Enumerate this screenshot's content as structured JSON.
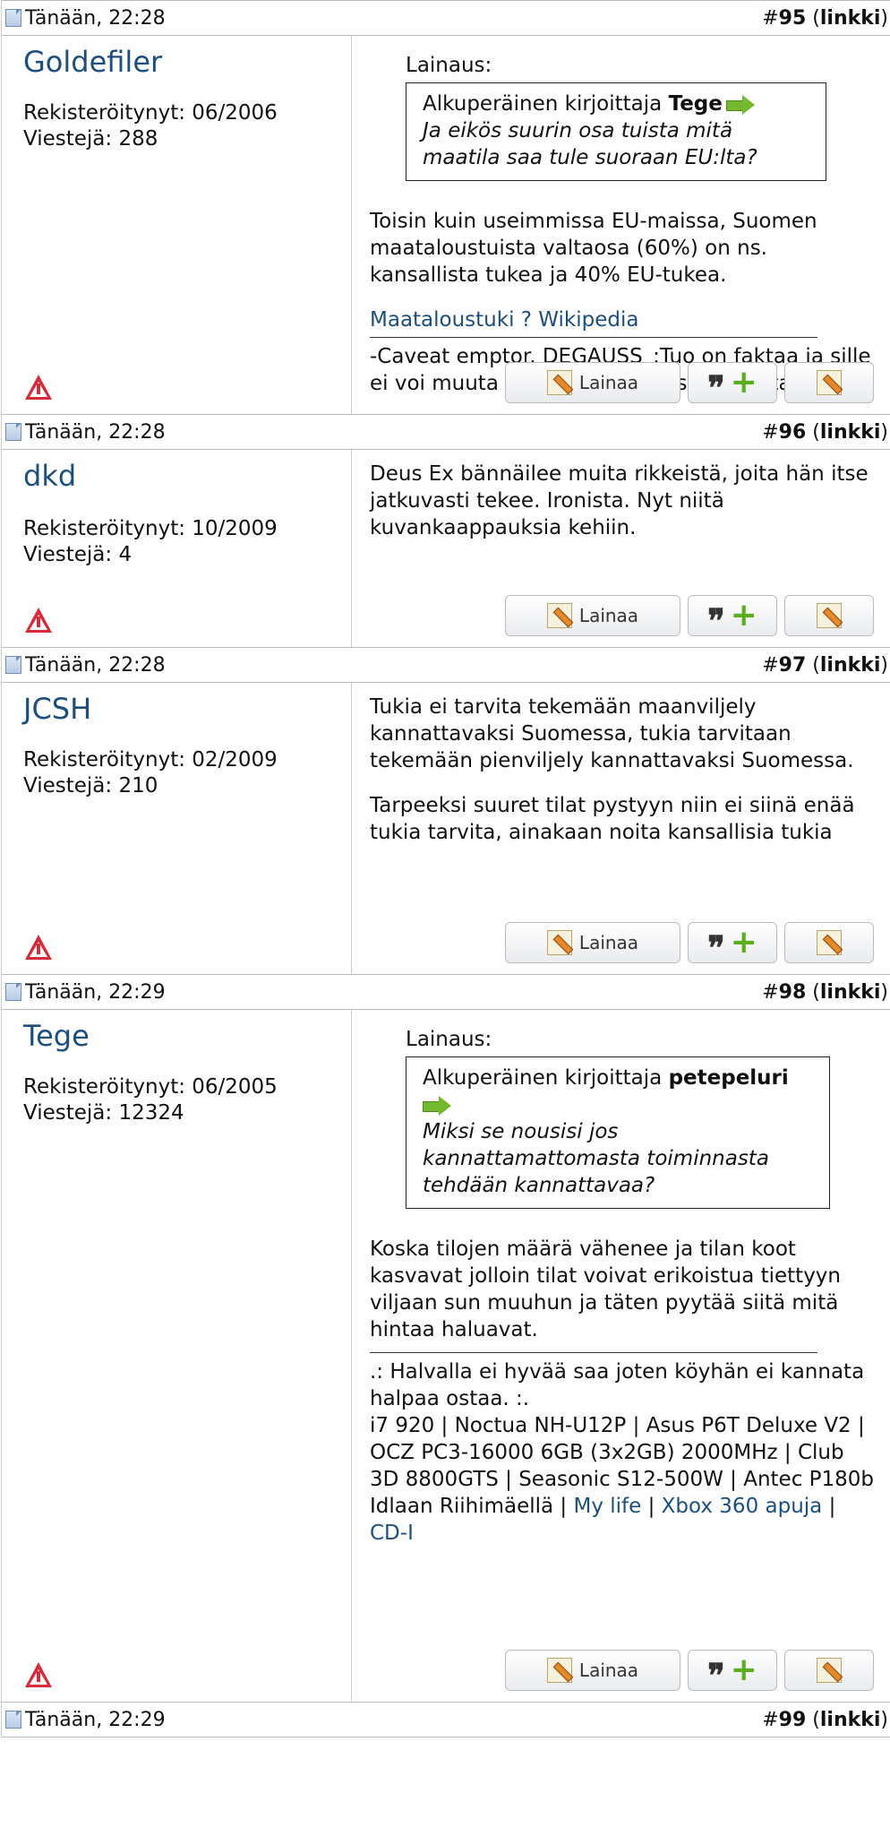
{
  "posts": [
    {
      "date": "Tänään, 22:28",
      "number": "95",
      "link_label": "linkki",
      "username": "Goldefiler",
      "registered": "Rekisteröitynyt: 06/2006",
      "posts_count": "Viestejä: 288",
      "quote": {
        "label": "Lainaus:",
        "author_prefix": "Alkuperäinen kirjoittaja",
        "author": "Tege",
        "text": "Ja eikös suurin osa tuista mitä maatila saa tule suoraan EU:lta?"
      },
      "paragraphs": [
        "Toisin kuin useimmissa EU-maissa, Suomen maataloustuista valtaosa (60%) on ns. kansallista tukea ja 40% EU-tukea."
      ],
      "link": "Maataloustuki ? Wikipedia",
      "signature": "-Caveat emptor. DEGAUSS_:Tuo on faktaa ja sille ei voi muuta kuin todeta että se on faktaa."
    },
    {
      "date": "Tänään, 22:28",
      "number": "96",
      "link_label": "linkki",
      "username": "dkd",
      "registered": "Rekisteröitynyt: 10/2009",
      "posts_count": "Viestejä: 4",
      "paragraphs": [
        "Deus Ex bännäilee muita rikkeistä, joita hän itse jatkuvasti tekee. Ironista. Nyt niitä kuvankaappauksia kehiin."
      ]
    },
    {
      "date": "Tänään, 22:28",
      "number": "97",
      "link_label": "linkki",
      "username": "JCSH",
      "registered": "Rekisteröitynyt: 02/2009",
      "posts_count": "Viestejä: 210",
      "paragraphs": [
        "Tukia ei tarvita tekemään maanviljely kannattavaksi Suomessa, tukia tarvitaan tekemään pienviljely kannattavaksi Suomessa.",
        "Tarpeeksi suuret tilat pystyyn niin ei siinä enää tukia tarvita, ainakaan noita kansallisia tukia"
      ]
    },
    {
      "date": "Tänään, 22:29",
      "number": "98",
      "link_label": "linkki",
      "username": "Tege",
      "registered": "Rekisteröitynyt: 06/2005",
      "posts_count": "Viestejä: 12324",
      "quote": {
        "label": "Lainaus:",
        "author_prefix": "Alkuperäinen kirjoittaja",
        "author": "petepeluri",
        "text": "Miksi se nousisi jos kannattamattomasta toiminnasta tehdään kannattavaa?"
      },
      "paragraphs": [
        "Koska tilojen määrä vähenee ja tilan koot kasvavat jolloin tilat voivat erikoistua tiettyyn viljaan sun muuhun ja täten pyytää siitä mitä hintaa haluavat."
      ],
      "signature_lines": [
        ".: Halvalla ei hyvää saa joten köyhän ei kannata halpaa ostaa. :.",
        "i7 920 | Noctua NH-U12P | Asus P6T Deluxe V2 | OCZ PC3-16000 6GB (3x2GB) 2000MHz | Club 3D 8800GTS | Seasonic S12-500W | Antec P180b"
      ],
      "signature_links": {
        "prefix": "Idlaan Riihimäellä |",
        "link1": "My life",
        "sep1": "|",
        "link2": "Xbox 360 apuja",
        "sep2": "|",
        "link3": "CD-I"
      }
    },
    {
      "date": "Tänään, 22:29",
      "number": "99",
      "link_label": "linkki"
    }
  ],
  "buttons": {
    "quote_label": "Lainaa",
    "multiquote_symbol": "❞",
    "multiquote_plus": "+"
  },
  "icons": [
    "page-icon",
    "warning-icon",
    "arrow-icon",
    "pencil-icon"
  ],
  "colors": {
    "username": "#1c4f7d",
    "link": "#1c4f7d",
    "warning": "#d82b3a",
    "arrow": "#73b82e"
  }
}
